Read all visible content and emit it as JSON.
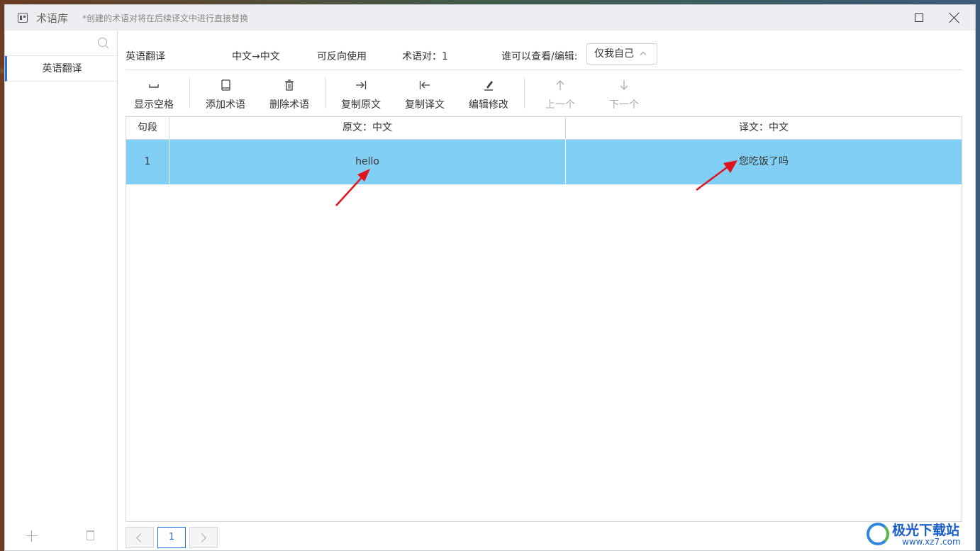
{
  "window": {
    "title": "术语库",
    "subtitle": "*创建的术语对将在后续译文中进行直接替换"
  },
  "sidebar": {
    "search_placeholder": "",
    "items": [
      {
        "label": "英语翻译"
      }
    ]
  },
  "infobar": {
    "name": "英语翻译",
    "direction": "中文→中文",
    "reversible": "可反向使用",
    "term_pairs": "术语对：1",
    "permission_label": "谁可以查看/编辑:",
    "permission_value": "仅我自己"
  },
  "toolbar": {
    "show_space": "显示空格",
    "add_term": "添加术语",
    "delete_term": "删除术语",
    "copy_source": "复制原文",
    "copy_target": "复制译文",
    "edit": "编辑修改",
    "prev": "上一个",
    "next": "下一个"
  },
  "table": {
    "headers": [
      "句段",
      "原文：中文",
      "译文：中文"
    ],
    "rows": [
      {
        "index": "1",
        "source": "hello",
        "target": "您吃饭了吗"
      }
    ]
  },
  "pager": {
    "current": "1"
  },
  "watermark": {
    "text": "极光下载站",
    "url": "www.xz7.com"
  },
  "colors": {
    "selected_row": "#82cff5",
    "accent": "#2a6ed6",
    "annotation_arrow": "#e0141c"
  }
}
